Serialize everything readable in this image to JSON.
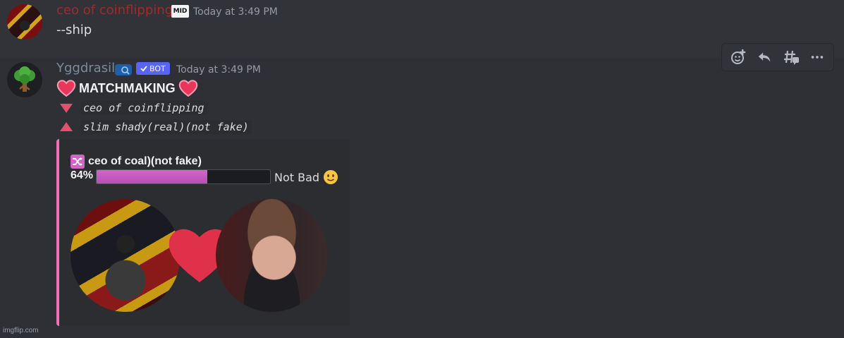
{
  "message1": {
    "username": "ceo of coinflipping",
    "badge": "MID",
    "timestamp": "Today at 3:49 PM",
    "content": "--ship"
  },
  "toolbar": {
    "icons": [
      "add-reaction-icon",
      "reply-icon",
      "create-thread-icon",
      "more-icon"
    ]
  },
  "message2": {
    "username": "Yggdrasil",
    "bot_tag": "BOT",
    "timestamp": "Today at 3:49 PM",
    "title": "MATCHMAKING",
    "user_a": "ceo of coinflipping",
    "user_b": "slim shady(real)(not fake)",
    "embed": {
      "ship_name": "ceo of coal)(not fake)",
      "percent_label": "64%",
      "percent_value": 0.64,
      "verdict": "Not Bad",
      "accent_color": "#ee71b3",
      "bar_color": "#c65bbf"
    }
  },
  "watermark": "imgflip.com"
}
